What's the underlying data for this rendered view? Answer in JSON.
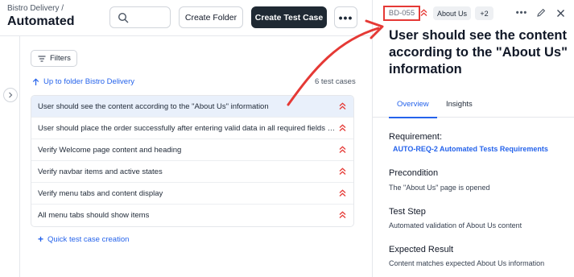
{
  "header": {
    "breadcrumb": "Bistro Delivery   /",
    "title": "Automated",
    "create_folder": "Create Folder",
    "create_test_case": "Create Test Case",
    "more": "•••"
  },
  "toolbar": {
    "filters": "Filters",
    "folder_link": "Up to folder Bistro Delivery",
    "count": "6 test cases",
    "quick_create": "Quick test case creation"
  },
  "test_cases": [
    {
      "title": "User should see the content according to the \"About Us\" information",
      "selected": true
    },
    {
      "title": "User should place the order successfully after entering valid data in all required fields and proceeding to checkout",
      "selected": false
    },
    {
      "title": "Verify Welcome page content and heading",
      "selected": false
    },
    {
      "title": "Verify navbar items and active states",
      "selected": false
    },
    {
      "title": "Verify menu tabs and content display",
      "selected": false
    },
    {
      "title": "All menu tabs should show items",
      "selected": false
    }
  ],
  "detail": {
    "id": "BD-055",
    "tag": "About Us",
    "extra_tags": "+2",
    "title": "User should see the content according to the \"About Us\" information",
    "tabs": [
      "Overview",
      "Insights"
    ],
    "requirement_label": "Requirement:",
    "requirement_value": "AUTO-REQ-2 Automated Tests Requirements",
    "precondition_label": "Precondition",
    "precondition_value": "The \"About Us\" page is opened",
    "test_step_label": "Test Step",
    "test_step_value": "Automated validation of About Us content",
    "expected_label": "Expected Result",
    "expected_value": "Content matches expected About Us information"
  },
  "colors": {
    "accent": "#2563eb",
    "priority": "#e53935",
    "annotation": "#e53935",
    "selected_row": "#e9f0fb",
    "dark_button": "#1f2933"
  }
}
